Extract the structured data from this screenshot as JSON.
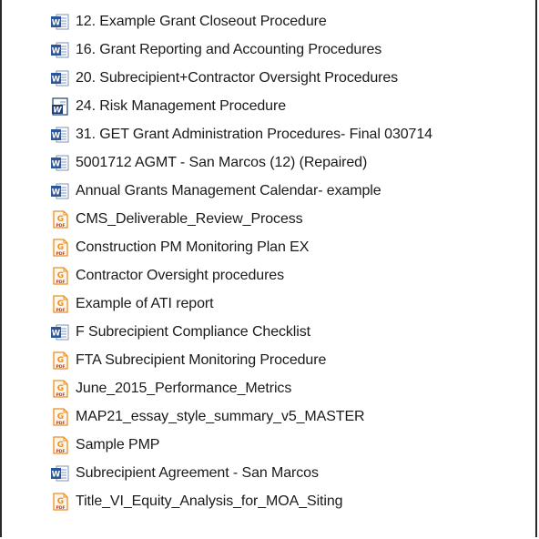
{
  "files": [
    {
      "name": "12. Example Grant Closeout Procedure",
      "icon": "word-doc-icon"
    },
    {
      "name": "16. Grant Reporting and Accounting Procedures",
      "icon": "word-doc-icon"
    },
    {
      "name": "20. Subrecipient+Contractor Oversight Procedures",
      "icon": "word-doc-icon"
    },
    {
      "name": "24. Risk Management Procedure",
      "icon": "word-legacy-doc-icon"
    },
    {
      "name": "31. GET Grant Administration Procedures- Final 030714",
      "icon": "word-doc-icon"
    },
    {
      "name": "5001712 AGMT - San Marcos (12) (Repaired)",
      "icon": "word-doc-icon"
    },
    {
      "name": "Annual Grants Management Calendar- example",
      "icon": "word-doc-icon"
    },
    {
      "name": "CMS_Deliverable_Review_Process",
      "icon": "pdf-icon"
    },
    {
      "name": "Construction PM Monitoring Plan EX",
      "icon": "pdf-icon"
    },
    {
      "name": "Contractor Oversight procedures",
      "icon": "pdf-icon"
    },
    {
      "name": "Example of ATI report",
      "icon": "pdf-icon"
    },
    {
      "name": "F  Subrecipient Compliance Checklist",
      "icon": "word-doc-icon"
    },
    {
      "name": "FTA Subrecipient Monitoring Procedure",
      "icon": "pdf-icon"
    },
    {
      "name": "June_2015_Performance_Metrics",
      "icon": "pdf-icon"
    },
    {
      "name": "MAP21_essay_style_summary_v5_MASTER",
      "icon": "pdf-icon"
    },
    {
      "name": "Sample PMP",
      "icon": "pdf-icon"
    },
    {
      "name": "Subrecipient  Agreement - San Marcos",
      "icon": "word-doc-icon"
    },
    {
      "name": "Title_VI_Equity_Analysis_for_MOA_Siting",
      "icon": "pdf-icon"
    }
  ],
  "icon_colors": {
    "word_blue": "#2b579a",
    "word_dark": "#1e3f73",
    "pdf_orange": "#e8902a",
    "pdf_label": "#c0392b"
  }
}
